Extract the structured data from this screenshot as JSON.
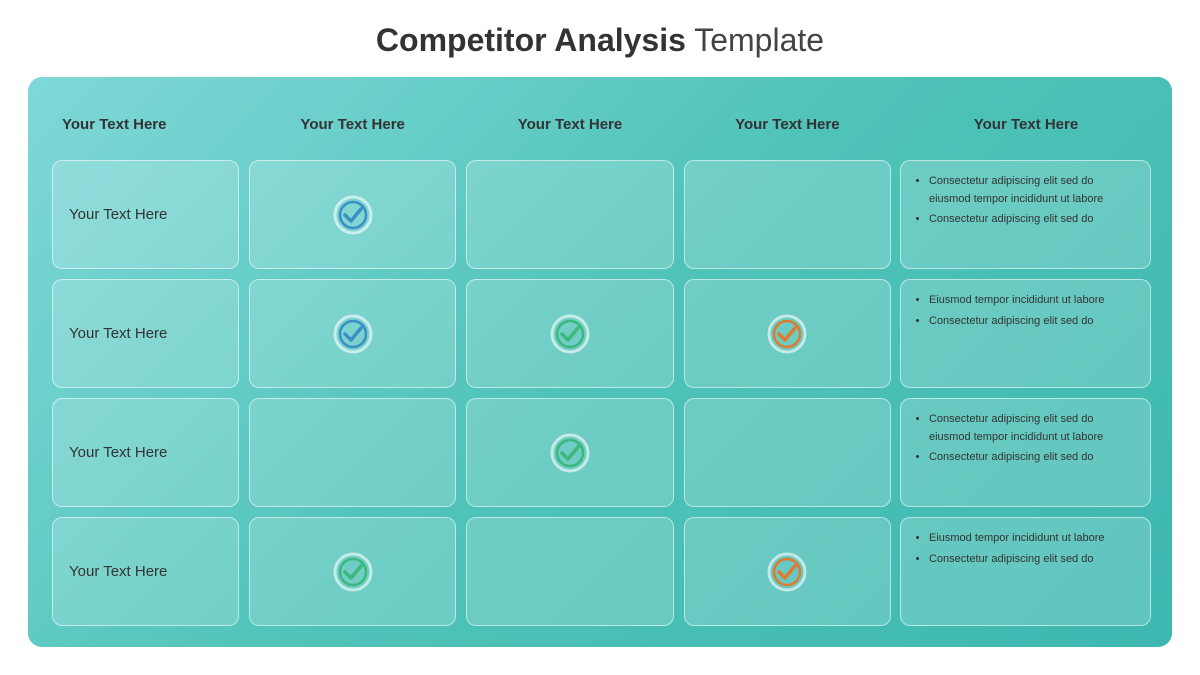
{
  "title": {
    "bold": "Competitor Analysis",
    "regular": " Template"
  },
  "columns": [
    {
      "id": "col-feature",
      "label": "Your Text Here"
    },
    {
      "id": "col-comp1",
      "label": "Your Text Here"
    },
    {
      "id": "col-comp2",
      "label": "Your Text Here"
    },
    {
      "id": "col-comp3",
      "label": "Your Text Here"
    },
    {
      "id": "col-notes",
      "label": "Your Text Here"
    }
  ],
  "rows": [
    {
      "label": "Your Text Here",
      "checks": [
        true,
        false,
        false
      ],
      "checkColors": [
        "blue",
        null,
        null
      ],
      "notes": [
        "Consectetur adipiscing elit sed do eiusmod tempor incididunt ut labore",
        "Consectetur adipiscing elit sed do"
      ]
    },
    {
      "label": "Your Text Here",
      "checks": [
        true,
        true,
        true
      ],
      "checkColors": [
        "blue",
        "green",
        "orange"
      ],
      "notes": [
        "Eiusmod tempor incididunt ut labore",
        "Consectetur adipiscing elit sed do"
      ]
    },
    {
      "label": "Your Text Here",
      "checks": [
        false,
        true,
        false
      ],
      "checkColors": [
        null,
        "green",
        null
      ],
      "notes": [
        "Consectetur adipiscing elit sed do eiusmod tempor incididunt ut labore",
        "Consectetur adipiscing elit sed do"
      ]
    },
    {
      "label": "Your Text Here",
      "checks": [
        true,
        false,
        true
      ],
      "checkColors": [
        "green",
        null,
        "orange"
      ],
      "notes": [
        "Eiusmod tempor incididunt ut labore",
        "Consectetur adipiscing elit sed do"
      ]
    }
  ],
  "checkColors": {
    "blue": "#3a8fc7",
    "green": "#3cb87a",
    "orange": "#e07a30"
  }
}
